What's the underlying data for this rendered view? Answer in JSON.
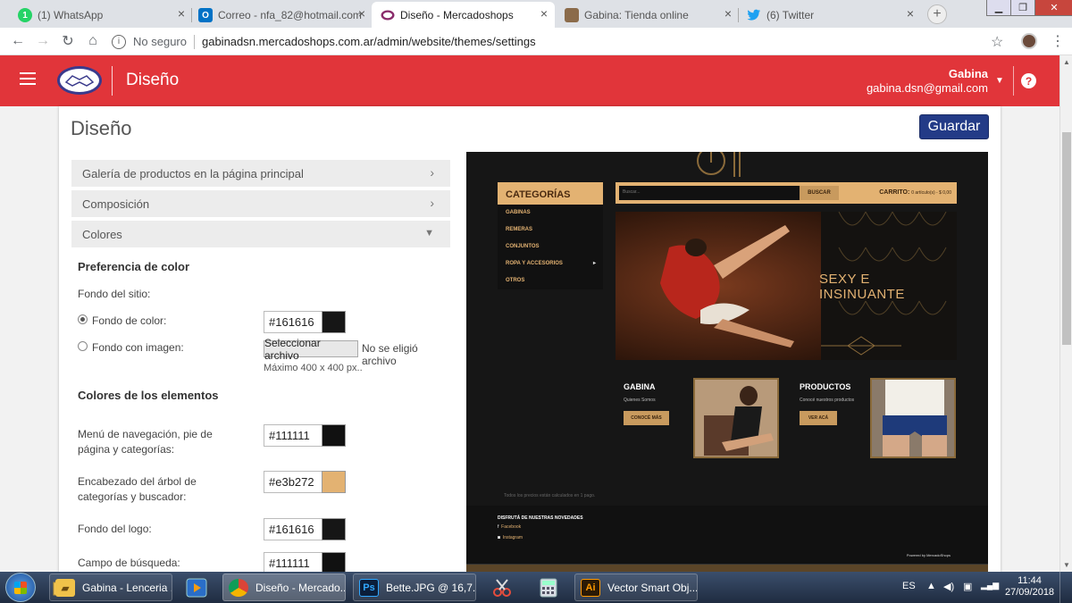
{
  "browser": {
    "tabs": [
      {
        "title": "(1) WhatsApp",
        "icon": "whatsapp-icon",
        "color": "#25d366",
        "badge": "1"
      },
      {
        "title": "Correo - nfa_82@hotmail.com",
        "icon": "outlook-icon",
        "color": "#0072c6",
        "badge": "O"
      },
      {
        "title": "Diseño - Mercadoshops",
        "icon": "mercadoshops-icon",
        "color": "#8a2b6b",
        "badge": ""
      },
      {
        "title": "Gabina: Tienda online",
        "icon": "shop-favicon",
        "color": "#8b6b4a",
        "badge": ""
      },
      {
        "title": "(6) Twitter",
        "icon": "twitter-icon",
        "color": "#1da1f2",
        "badge": ""
      }
    ],
    "address": {
      "not_secure": "No seguro",
      "url": "gabinadsn.mercadoshops.com.ar/admin/website/themes/settings"
    }
  },
  "header": {
    "section_title": "Diseño",
    "user_name": "Gabina",
    "user_email": "gabina.dsn@gmail.com",
    "brand_color": "#e1353a"
  },
  "page": {
    "title": "Diseño",
    "save_label": "Guardar"
  },
  "settings": {
    "sections": [
      {
        "label": "Galería de productos en la página principal"
      },
      {
        "label": "Composición"
      },
      {
        "label": "Colores"
      }
    ],
    "color_pref_title": "Preferencia de color",
    "site_bg_label": "Fondo del sitio:",
    "bg_color_option": "Fondo de color:",
    "bg_color_value": "#161616",
    "bg_image_option": "Fondo con imagen:",
    "file_button": "Seleccionar archivo",
    "no_file": "No se eligió archivo",
    "max_size": "Máximo 400 x 400 px..",
    "elements_title": "Colores de los elementos",
    "elements": [
      {
        "label": "Menú de navegación, pie de página y categorías:",
        "value": "#111111"
      },
      {
        "label": "Encabezado del árbol de categorías y buscador:",
        "value": "#e3b272"
      },
      {
        "label": "Fondo del logo:",
        "value": "#161616"
      },
      {
        "label": "Campo de búsqueda:",
        "value": "#111111"
      }
    ]
  },
  "preview": {
    "categories_title": "CATEGORÍAS",
    "categories": [
      "GABINAS",
      "REMERAS",
      "CONJUNTOS",
      "ROPA Y ACCESORIOS",
      "OTROS"
    ],
    "search_placeholder": "Buscar...",
    "search_button": "BUSCAR",
    "cart_label": "CARRITO:",
    "cart_summary": "0 artículo(s) - $ 0,00",
    "banner_text": "SEXY E INSINUANTE",
    "tiles": [
      {
        "title": "GABINA",
        "subtitle": "Quienes Somos",
        "button": "CONOCÉ MÁS"
      },
      {
        "title": "PRODUCTOS",
        "subtitle": "Conocé nuestros productos",
        "button": "VER ACÁ"
      }
    ],
    "prices_note": "Todos los precios están calculados en 1 pago.",
    "newsletter": "DISFRUTÁ DE NUESTRAS NOVEDADES",
    "social": [
      "Facebook",
      "Instagram"
    ],
    "powered": "Powered by MercadoShops"
  },
  "taskbar": {
    "items": [
      {
        "label": "Gabina - Lenceria ...",
        "icon": "folder-icon"
      },
      {
        "label": "Diseño - Mercado...",
        "icon": "chrome-icon"
      },
      {
        "label": "Bette.JPG @ 16,7...",
        "icon": "photoshop-icon"
      },
      {
        "label": "Vector Smart Obj...",
        "icon": "illustrator-icon"
      }
    ],
    "language": "ES",
    "time": "11:44",
    "date": "27/09/2018"
  }
}
